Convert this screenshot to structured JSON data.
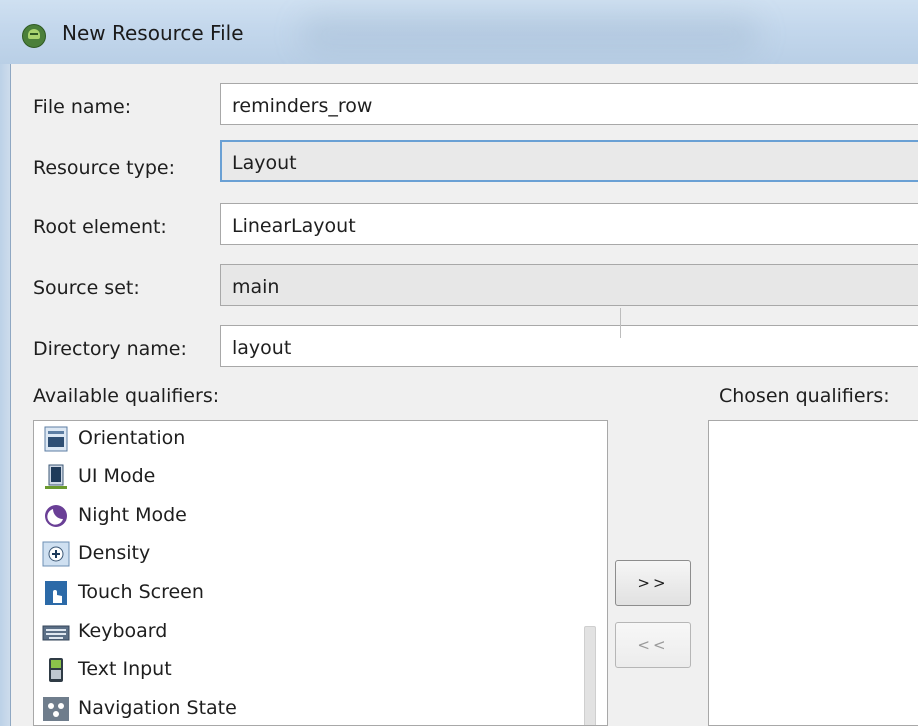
{
  "window": {
    "title": "New Resource File"
  },
  "form": {
    "file_name_label": "File name:",
    "file_name_value": "reminders_row",
    "resource_type_label": "Resource type:",
    "resource_type_value": "Layout",
    "root_element_label": "Root element:",
    "root_element_value": "LinearLayout",
    "source_set_label": "Source set:",
    "source_set_value": "main",
    "directory_name_label": "Directory name:",
    "directory_name_value": "layout"
  },
  "qualifiers": {
    "available_label": "Available qualifiers:",
    "chosen_label": "Chosen qualifiers:",
    "items": [
      {
        "label": "Orientation",
        "icon": "orientation-icon"
      },
      {
        "label": "UI Mode",
        "icon": "ui-mode-icon"
      },
      {
        "label": "Night Mode",
        "icon": "night-mode-icon"
      },
      {
        "label": "Density",
        "icon": "density-icon"
      },
      {
        "label": "Touch Screen",
        "icon": "touch-screen-icon"
      },
      {
        "label": "Keyboard",
        "icon": "keyboard-icon"
      },
      {
        "label": "Text Input",
        "icon": "text-input-icon"
      },
      {
        "label": "Navigation State",
        "icon": "navigation-state-icon"
      }
    ],
    "add_button": ">>",
    "remove_button": "<<"
  }
}
